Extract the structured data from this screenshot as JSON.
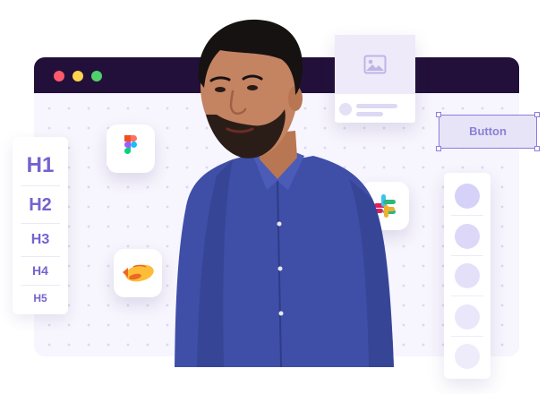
{
  "browser": {
    "window_dots": [
      "red",
      "yellow",
      "green"
    ],
    "colors": {
      "titlebar": "#22103a",
      "red": "#ff5a6b",
      "yellow": "#ffd34e",
      "green": "#4fd06b",
      "canvas": "#f7f5fd"
    }
  },
  "heading_scale": {
    "items": [
      "H1",
      "H2",
      "H3",
      "H4",
      "H5"
    ],
    "color": "#7363cf"
  },
  "app_icons": [
    "figma-icon",
    "slack-icon",
    "zeplin-icon"
  ],
  "image_card": {
    "icon": "image-icon"
  },
  "button_mock": {
    "label": "Button",
    "accent": "#8a7ee0"
  },
  "circle_list": {
    "count": 5
  },
  "photo": {
    "subject": "person-photo",
    "shirt_color": "#3f4fa8"
  }
}
